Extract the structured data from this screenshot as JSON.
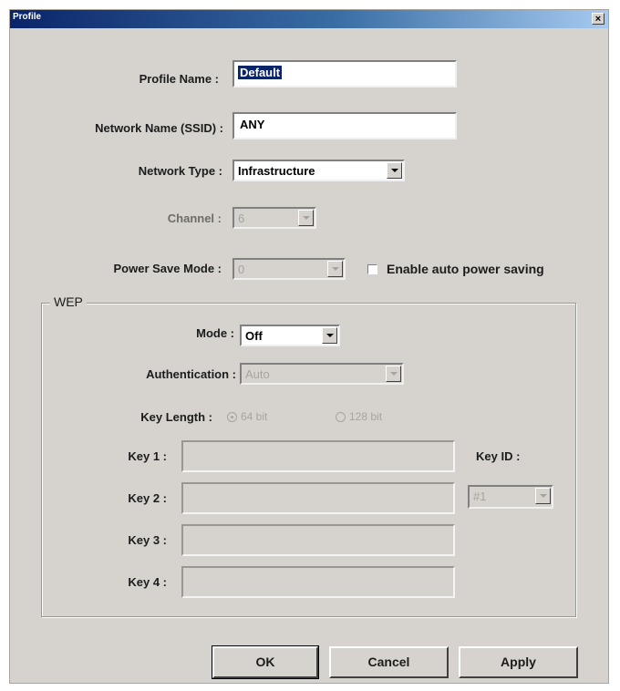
{
  "window": {
    "title": "Profile",
    "close_glyph": "×"
  },
  "profile_name": {
    "label": "Profile Name :",
    "value": "Default"
  },
  "ssid": {
    "label": "Network Name (SSID) :",
    "value": "ANY"
  },
  "network_type": {
    "label": "Network Type :",
    "value": "Infrastructure"
  },
  "channel": {
    "label": "Channel :",
    "value": "6"
  },
  "power_save": {
    "label": "Power Save Mode :",
    "value": "0",
    "auto_label": "Enable auto power saving",
    "auto_checked": false
  },
  "wep": {
    "legend": "WEP",
    "mode": {
      "label": "Mode :",
      "value": "Off"
    },
    "authentication": {
      "label": "Authentication :",
      "value": "Auto"
    },
    "key_length": {
      "label": "Key Length :",
      "option_64": "64 bit",
      "option_128": "128 bit",
      "selected": "64 bit"
    },
    "keys": [
      {
        "label": "Key 1 :",
        "value": ""
      },
      {
        "label": "Key 2 :",
        "value": ""
      },
      {
        "label": "Key 3 :",
        "value": ""
      },
      {
        "label": "Key 4 :",
        "value": ""
      }
    ],
    "key_id": {
      "label": "Key ID :",
      "value": "#1"
    }
  },
  "buttons": {
    "ok": "OK",
    "cancel": "Cancel",
    "apply": "Apply"
  }
}
